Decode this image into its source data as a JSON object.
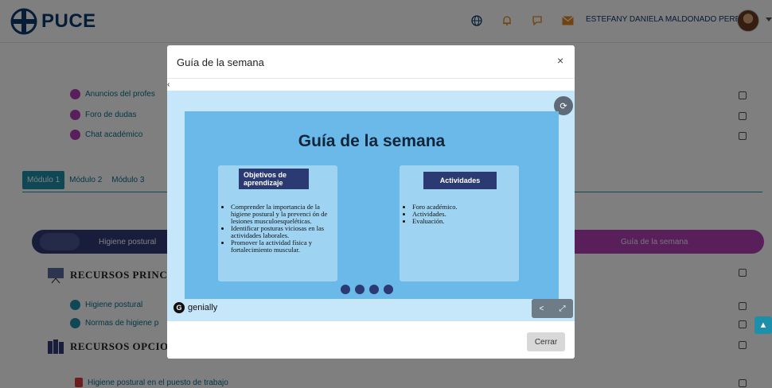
{
  "header": {
    "logo_text": "PUCE",
    "user_name": "ESTEFANY DANIELA MALDONADO PEREZ",
    "icons": [
      "globe-icon",
      "bell-icon",
      "chat-icon",
      "mail-icon"
    ]
  },
  "activities": [
    {
      "label": "Anuncios del profes",
      "color": "#b23fb7"
    },
    {
      "label": "Foro de dudas",
      "color": "#b23fb7"
    },
    {
      "label": "Chat académico",
      "color": "#b23fb7"
    }
  ],
  "tabs": [
    "Módulo 1",
    "Módulo 2",
    "Módulo 3"
  ],
  "banner": {
    "left_label": "Higiene postural",
    "right_label": "Guía de la semana"
  },
  "sections": {
    "principal": "RECURSOS PRINCI",
    "opcional": "RECURSOS OPCIO"
  },
  "resources": [
    {
      "label": "Higiene postural"
    },
    {
      "label": "Normas de higiene p"
    }
  ],
  "optional_resources": [
    {
      "label": "Higiene postural en el puesto de trabajo"
    }
  ],
  "modal": {
    "title": "Guía de la semana",
    "close_glyph": "×",
    "back_glyph": "‹",
    "slide_title": "Guía de la semana",
    "card_left": {
      "tag": "Objetivos de aprendizaje",
      "items": [
        "Comprender la importancia de la higiene postural y la prevenci ón de lesiones musculoesqueléticas.",
        "Identificar posturas viciosas en las actividades laborales.",
        "Promover la actividad física y fortalecimiento muscular."
      ]
    },
    "card_right": {
      "tag": "Actividades",
      "items": [
        "Foro académico.",
        "Actividades.",
        "Evaluación."
      ]
    },
    "brand": "genially",
    "close_button": "Cerrar"
  },
  "colors": {
    "brand_navy": "#0b3a6e",
    "accent_teal": "#1e8fa8",
    "magenta": "#b23fb7"
  }
}
